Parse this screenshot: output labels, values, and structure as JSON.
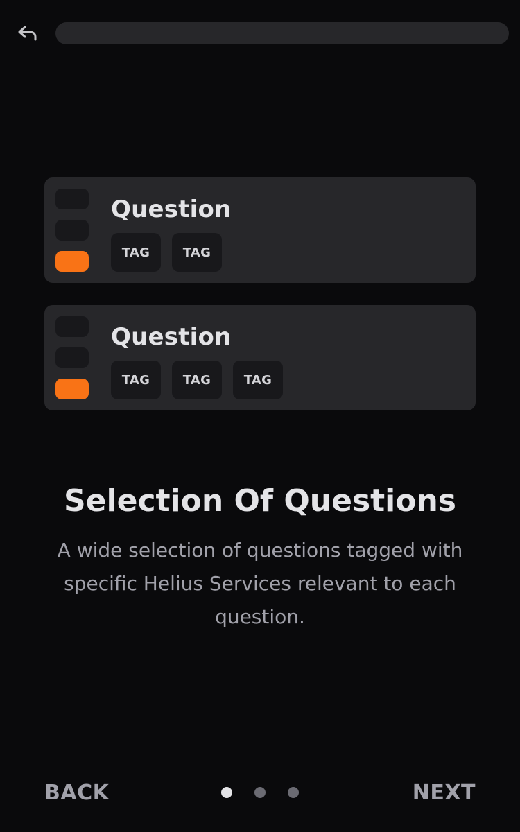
{
  "header": {
    "back_icon": "undo-arrow-icon",
    "progress": 0.0
  },
  "cards": [
    {
      "title": "Question",
      "tags": [
        "TAG",
        "TAG"
      ],
      "vote_indicators": [
        "inactive",
        "inactive",
        "active"
      ]
    },
    {
      "title": "Question",
      "tags": [
        "TAG",
        "TAG",
        "TAG"
      ],
      "vote_indicators": [
        "inactive",
        "inactive",
        "active"
      ]
    }
  ],
  "intro": {
    "heading": "Selection Of Questions",
    "description": "A wide selection of questions tagged with specific Helius Services relevant to each question."
  },
  "footer": {
    "back_label": "BACK",
    "next_label": "NEXT",
    "pages": 3,
    "current_page": 1
  },
  "colors": {
    "background": "#0a0a0c",
    "card": "#27272a",
    "accent": "#f97316",
    "text_primary": "#e4e4e7",
    "text_secondary": "#a1a1aa"
  }
}
